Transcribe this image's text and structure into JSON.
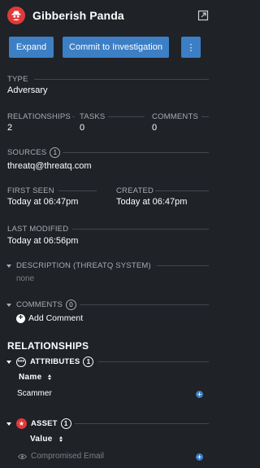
{
  "header": {
    "title": "Gibberish Panda",
    "avatar_icon": "spy-icon",
    "popout_icon": "external-link-icon"
  },
  "buttons": {
    "expand": "Expand",
    "commit": "Commit to Investigation",
    "more": "⋮"
  },
  "type": {
    "label": "TYPE",
    "value": "Adversary"
  },
  "counts": {
    "relationships": {
      "label": "RELATIONSHIPS",
      "value": "2"
    },
    "tasks": {
      "label": "TASKS",
      "value": "0"
    },
    "comments": {
      "label": "COMMENTS",
      "value": "0"
    }
  },
  "sources": {
    "label": "SOURCES",
    "count": "1",
    "value": "threatq@threatq.com"
  },
  "first_seen": {
    "label": "FIRST SEEN",
    "value": "Today at 06:47pm"
  },
  "created": {
    "label": "CREATED",
    "value": "Today at 06:47pm"
  },
  "last_modified": {
    "label": "LAST MODIFIED",
    "value": "Today at 06:56pm"
  },
  "description": {
    "label": "DESCRIPTION (THREATQ SYSTEM)",
    "value": "none"
  },
  "comments_section": {
    "label": "COMMENTS",
    "count": "0",
    "add_label": "Add Comment"
  },
  "relationships": {
    "title": "RELATIONSHIPS",
    "attributes": {
      "label": "ATTRIBUTES",
      "count": "1",
      "column": "Name",
      "row": "Scammer"
    },
    "asset": {
      "label": "ASSET",
      "count": "1",
      "column": "Value",
      "row": "Compromised Email"
    }
  },
  "colors": {
    "background": "#1f2227",
    "accent": "#3c7fc5",
    "brand_red": "#e0393a"
  }
}
